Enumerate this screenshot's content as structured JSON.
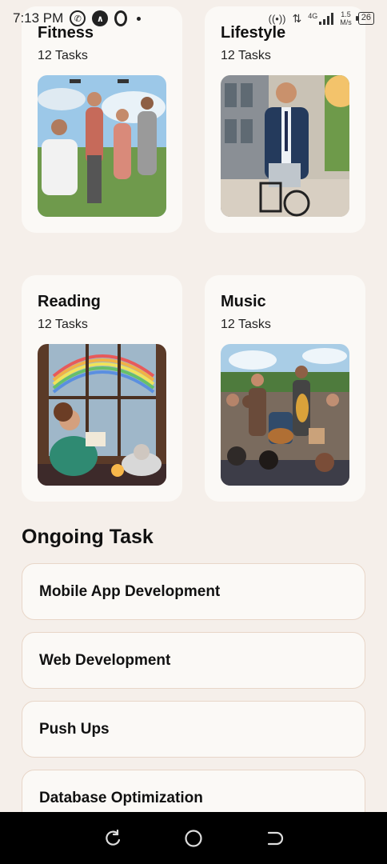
{
  "status": {
    "time": "7:13 PM",
    "icons": [
      "whatsapp-icon",
      "a-app-icon",
      "opera-icon",
      "dot-icon",
      "hotspot-icon",
      "data-arrows-icon",
      "signal-icon",
      "battery-icon"
    ],
    "network_type": "4G",
    "speed_value": "1.5",
    "speed_unit": "M/s",
    "battery": "26"
  },
  "categories": [
    {
      "title": "Fitness",
      "tasks": "12 Tasks",
      "image": "group fitness workout outdoors"
    },
    {
      "title": "Lifestyle",
      "tasks": "12 Tasks",
      "image": "businessman riding bicycle"
    },
    {
      "title": "Reading",
      "tasks": "12 Tasks",
      "image": "girl reading by rainy window"
    },
    {
      "title": "Music",
      "tasks": "12 Tasks",
      "image": "outdoor band performance"
    }
  ],
  "ongoing": {
    "title": "Ongoing Task",
    "tasks": [
      "Mobile App Development",
      "Web Development",
      "Push Ups",
      "Database Optimization"
    ]
  },
  "nav": {
    "icons": [
      "recents-icon",
      "home-icon",
      "back-icon"
    ]
  },
  "colors": {
    "background": "#f5efea",
    "card": "#fbf9f6",
    "task_border": "#e8d6c8",
    "nav_bar": "#000000"
  }
}
